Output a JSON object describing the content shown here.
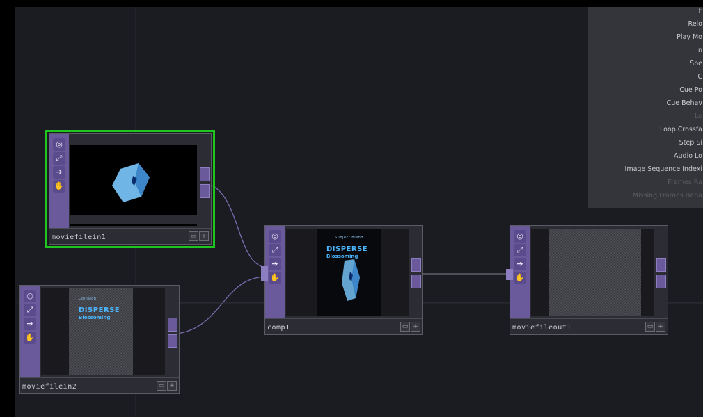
{
  "nodes": {
    "moviefilein1": {
      "label": "moviefilein1"
    },
    "moviefilein2": {
      "label": "moviefilein2",
      "poster": {
        "top": "Collision",
        "title": "DISPERSE",
        "subtitle": "Blossoming"
      }
    },
    "comp1": {
      "label": "comp1",
      "poster": {
        "top": "Subject Blend",
        "title": "DISPERSE",
        "subtitle": "Blossoming"
      }
    },
    "moviefileout1": {
      "label": "moviefileout1"
    }
  },
  "node_toolbar_icons": [
    "viewer-icon",
    "bypass-icon",
    "display-icon",
    "lock-icon"
  ],
  "parameters": {
    "rows": [
      {
        "label": "F",
        "dim": false
      },
      {
        "label": "Relo",
        "dim": false
      },
      {
        "label": "Play Mo",
        "dim": false
      },
      {
        "label": "In",
        "dim": false
      },
      {
        "label": "Spe",
        "dim": false
      },
      {
        "label": "C",
        "dim": false
      },
      {
        "label": "Cue Po",
        "dim": false
      },
      {
        "label": "Cue Behav",
        "dim": false
      },
      {
        "label": "Lo",
        "dim": true
      },
      {
        "label": "Loop Crossfa",
        "dim": false
      },
      {
        "label": "Step Si",
        "dim": false
      },
      {
        "label": "Audio Lo",
        "dim": false
      },
      {
        "label": "Image Sequence Indexi",
        "dim": false
      },
      {
        "label": "Frames Ra",
        "dim": true
      },
      {
        "label": "Missing Frames Beha",
        "dim": true
      }
    ]
  },
  "colors": {
    "canvas_bg": "#1b1c22",
    "node_toolbar": "#6a5a9c",
    "selection": "#1fc61f",
    "wire": "#7a6db0",
    "param_panel": "#34353b"
  }
}
